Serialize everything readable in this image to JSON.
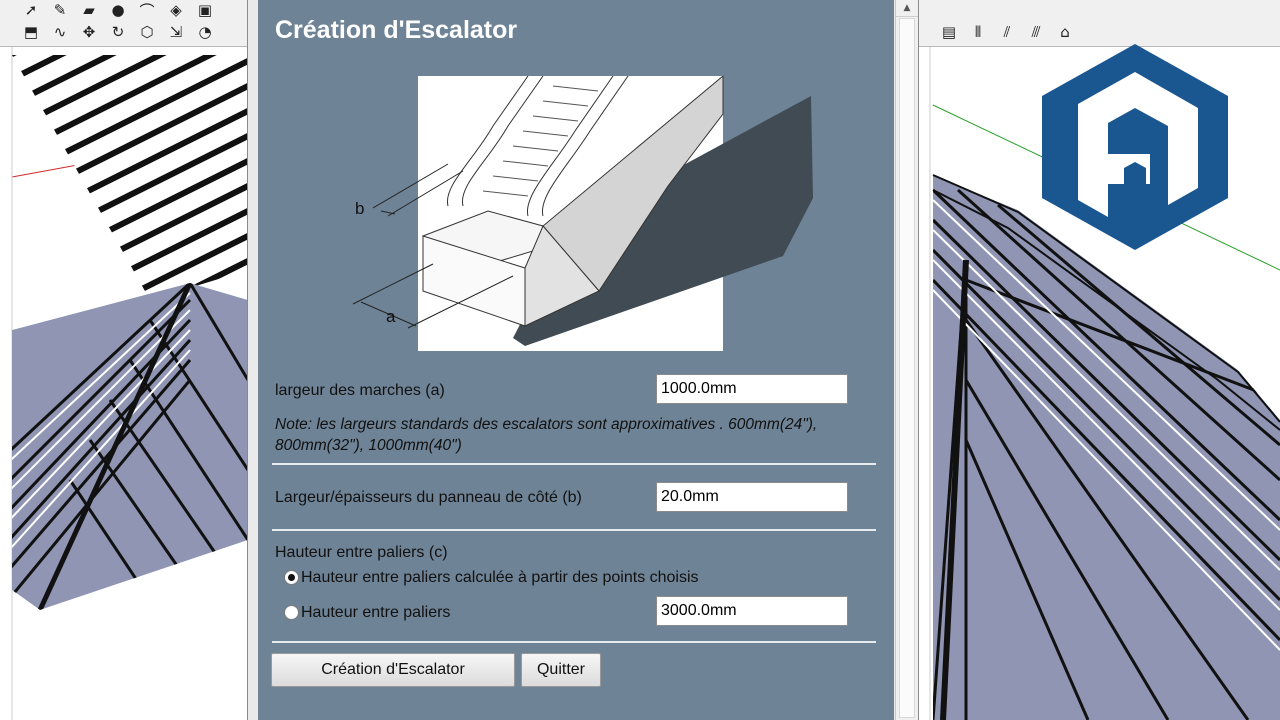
{
  "dialog": {
    "title": "Création d'Escalator",
    "illustration": {
      "label_a": "a",
      "label_b": "b"
    },
    "step_width": {
      "label": "largeur des marches  (a)",
      "value": "1000.0mm"
    },
    "note": "Note: les largeurs standards des escalators sont approximatives . 600mm(24\"), 800mm(32\"), 1000mm(40\")",
    "side_panel": {
      "label": "Largeur/épaisseurs du panneau de côté  (b)",
      "value": "20.0mm"
    },
    "landing_height": {
      "label": "Hauteur entre paliers (c)",
      "option_calculated": "Hauteur entre paliers calculée à partir des points choisis",
      "option_manual": "Hauteur entre paliers",
      "manual_value": "3000.0mm",
      "selected": "calculated"
    },
    "buttons": {
      "create": "Création d'Escalator",
      "quit": "Quitter"
    }
  },
  "toolbar_left_icons": [
    "select-arrow-icon",
    "pencil-icon",
    "eraser-icon",
    "paint-bucket-icon",
    "arc-icon",
    "push-pull-icon",
    "move-icon",
    "rotate-icon",
    "offset-icon",
    "tape-measure-icon"
  ],
  "toolbar_right_icons": [
    "section-plane-icon",
    "wall-tool-icon",
    "roof-tool-icon",
    "stair-tool-icon",
    "house-tool-icon"
  ],
  "logo": {
    "name": "sketchup-logo",
    "color": "#1a5690"
  },
  "colors": {
    "dialog_panel": "#6f8396",
    "roof_fill": "#8f95b3",
    "axis_red": "#d42a2a",
    "axis_green": "#2aa02a"
  }
}
